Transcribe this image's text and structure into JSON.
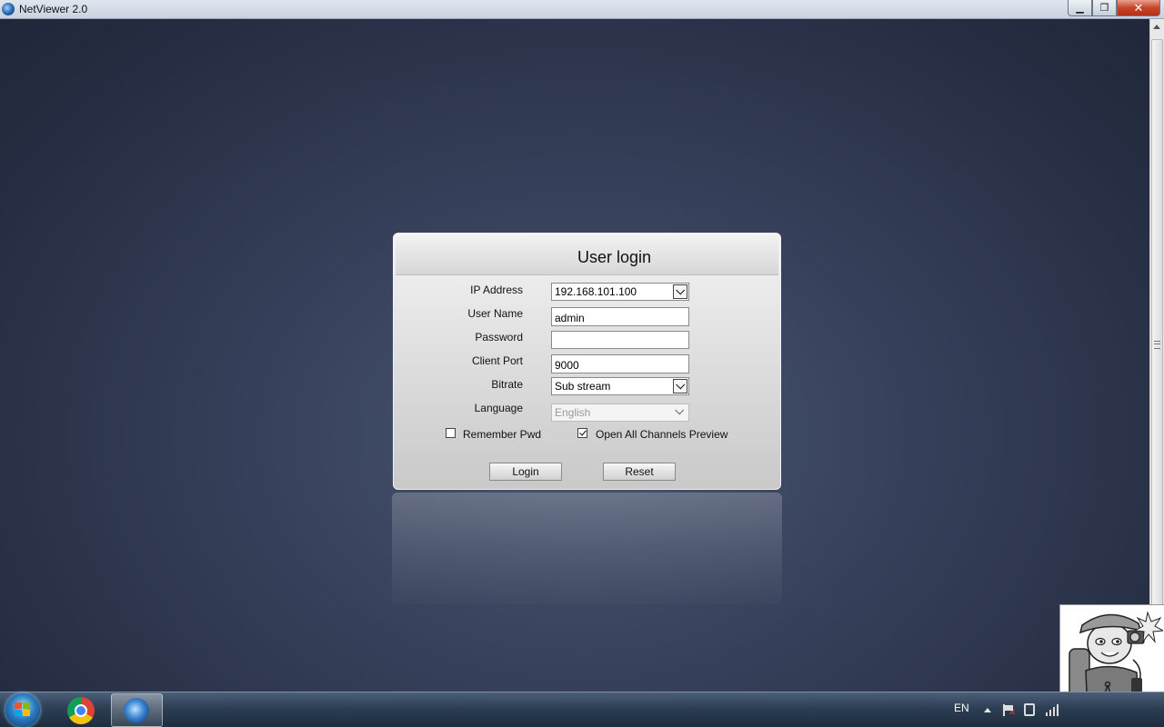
{
  "window": {
    "title": "NetViewer 2.0",
    "minimize_glyph": "▁",
    "maximize_glyph": "❐",
    "close_glyph": "✕"
  },
  "login": {
    "title": "User login",
    "ip_label": "IP Address",
    "ip_value": "192.168.101.100",
    "username_label": "User Name",
    "username_value": "admin",
    "password_label": "Password",
    "password_value": "",
    "port_label": "Client Port",
    "port_value": "9000",
    "bitrate_label": "Bitrate",
    "bitrate_value": "Sub stream",
    "language_label": "Language",
    "language_value": "English",
    "remember_label": "Remember Pwd",
    "remember_checked": false,
    "preview_label": "Open All Channels Preview",
    "preview_checked": true,
    "login_button": "Login",
    "reset_button": "Reset"
  },
  "taskbar": {
    "language": "EN",
    "apps": [
      "start-orb",
      "chrome",
      "netviewer"
    ]
  },
  "colors": {
    "desktop": "#2b3449",
    "panel": "#e2e2e2",
    "close_button": "#c7452a",
    "taskbar": "#2d3e53"
  }
}
